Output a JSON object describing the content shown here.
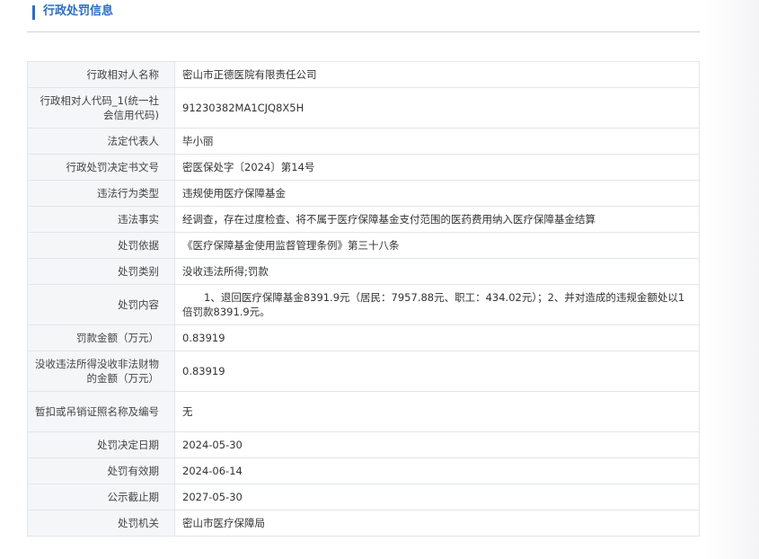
{
  "section": {
    "title": "行政处罚信息"
  },
  "rows": [
    {
      "label": "行政相对人名称",
      "value": "密山市正德医院有限责任公司"
    },
    {
      "label": "行政相对人代码_1(统一社会信用代码)",
      "value": "91230382MA1CJQ8X5H"
    },
    {
      "label": "法定代表人",
      "value": "毕小丽"
    },
    {
      "label": "行政处罚决定书文号",
      "value": "密医保处字〔2024〕第14号"
    },
    {
      "label": "违法行为类型",
      "value": "违规使用医疗保障基金"
    },
    {
      "label": "违法事实",
      "value": "经调查，存在过度检查、将不属于医疗保障基金支付范围的医药费用纳入医疗保障基金结算"
    },
    {
      "label": "处罚依据",
      "value": "《医疗保障基金使用监督管理条例》第三十八条"
    },
    {
      "label": "处罚类别",
      "value": "没收违法所得;罚款"
    },
    {
      "label": "处罚内容",
      "value": "1、退回医疗保障基金8391.9元（居民：7957.88元、职工：434.02元）；2、并对造成的违规金额处以1倍罚款8391.9元。"
    },
    {
      "label": "罚款金额（万元）",
      "value": "0.83919"
    },
    {
      "label": "没收违法所得没收非法财物的金额（万元）",
      "value": "0.83919"
    },
    {
      "label": "暂扣或吊销证照名称及编号",
      "value": "无"
    },
    {
      "label": "处罚决定日期",
      "value": "2024-05-30"
    },
    {
      "label": "处罚有效期",
      "value": "2024-06-14"
    },
    {
      "label": "公示截止期",
      "value": "2027-05-30"
    },
    {
      "label": "处罚机关",
      "value": "密山市医疗保障局"
    }
  ]
}
